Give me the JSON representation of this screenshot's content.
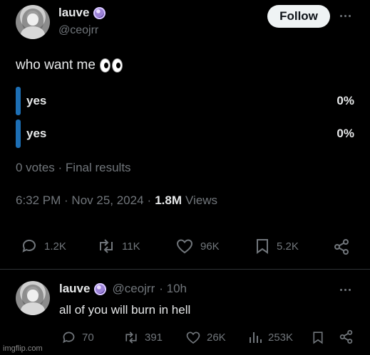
{
  "post": {
    "display_name": "lauve",
    "handle": "@ceojrr",
    "follow_label": "Follow",
    "text": "who want me",
    "emoji_icon": "eyes-emoji-icon",
    "poll": {
      "options": [
        {
          "label": "yes",
          "percent": "0%"
        },
        {
          "label": "yes",
          "percent": "0%"
        }
      ],
      "summary": "0 votes · Final results"
    },
    "time": "6:32 PM · Nov 25, 2024",
    "views_sep": "·",
    "views_count": "1.8M",
    "views_label": "Views",
    "stats": {
      "replies": "1.2K",
      "reposts": "11K",
      "likes": "96K",
      "bookmarks": "5.2K"
    }
  },
  "reply": {
    "display_name": "lauve",
    "handle": "@ceojrr",
    "time": "· 10h",
    "text": "all of you will burn in hell",
    "stats": {
      "replies": "70",
      "reposts": "391",
      "likes": "26K",
      "views": "253K"
    }
  },
  "watermark": "imgflip.com",
  "colors": {
    "background": "#000000",
    "text": "#e7e9ea",
    "muted": "#71767b",
    "poll_bar": "#1d6fb5",
    "follow_bg": "#eff3f4"
  }
}
